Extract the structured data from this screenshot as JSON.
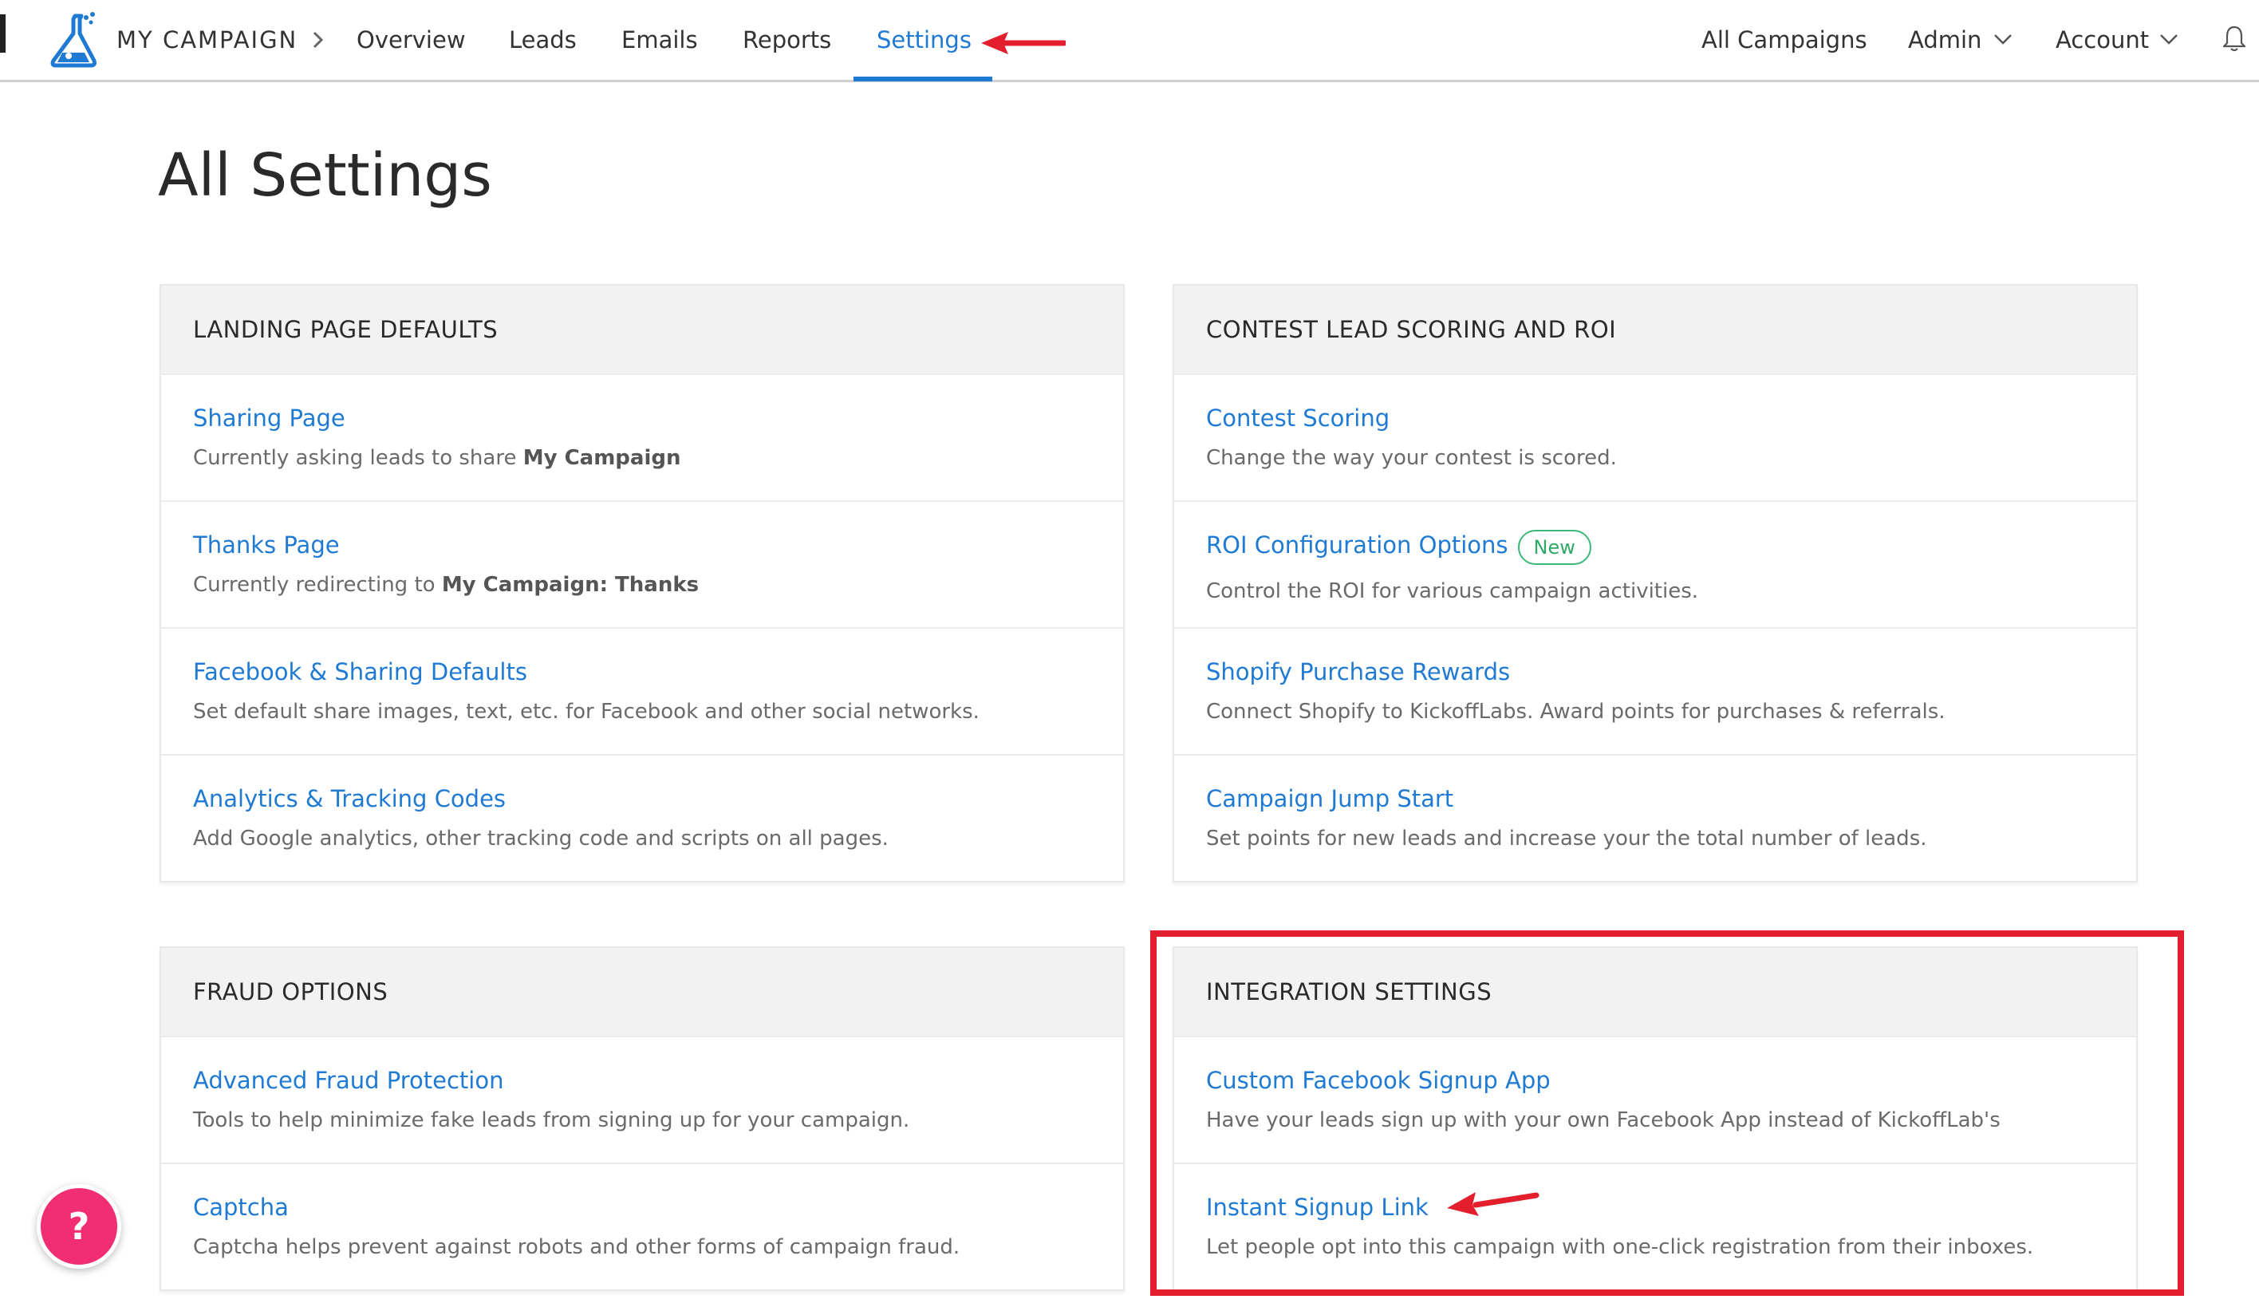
{
  "nav": {
    "brand": "MY CAMPAIGN",
    "tabs": [
      {
        "label": "Overview"
      },
      {
        "label": "Leads"
      },
      {
        "label": "Emails"
      },
      {
        "label": "Reports"
      },
      {
        "label": "Settings",
        "active": true
      }
    ],
    "right": {
      "all_campaigns": "All Campaigns",
      "admin": "Admin",
      "account": "Account"
    },
    "icons": [
      "flask-logo-icon",
      "chevron-right-icon",
      "chevron-down-icon",
      "bell-icon"
    ]
  },
  "page": {
    "title": "All Settings"
  },
  "sections": {
    "landing": {
      "heading": "LANDING PAGE DEFAULTS",
      "rows": [
        {
          "link": "Sharing Page",
          "desc": "Currently asking leads to share ",
          "strong": "My Campaign"
        },
        {
          "link": "Thanks Page",
          "desc": "Currently redirecting to ",
          "strong": "My Campaign: Thanks"
        },
        {
          "link": "Facebook & Sharing Defaults",
          "desc": "Set default share images, text, etc. for Facebook and other social networks."
        },
        {
          "link": "Analytics & Tracking Codes",
          "desc": "Add Google analytics, other tracking code and scripts on all pages."
        }
      ]
    },
    "contest": {
      "heading": "CONTEST LEAD SCORING AND ROI",
      "rows": [
        {
          "link": "Contest Scoring",
          "desc": "Change the way your contest is scored."
        },
        {
          "link": "ROI Configuration Options",
          "badge": "New",
          "desc": "Control the ROI for various campaign activities."
        },
        {
          "link": "Shopify Purchase Rewards",
          "desc": "Connect Shopify to KickoffLabs. Award points for purchases & referrals."
        },
        {
          "link": "Campaign Jump Start",
          "desc": "Set points for new leads and increase your the total number of leads."
        }
      ]
    },
    "fraud": {
      "heading": "FRAUD OPTIONS",
      "rows": [
        {
          "link": "Advanced Fraud Protection",
          "desc": "Tools to help minimize fake leads from signing up for your campaign."
        },
        {
          "link": "Captcha",
          "desc": "Captcha helps prevent against robots and other forms of campaign fraud."
        }
      ]
    },
    "integration": {
      "heading": "INTEGRATION SETTINGS",
      "rows": [
        {
          "link": "Custom Facebook Signup App",
          "desc": "Have your leads sign up with your own Facebook App instead of KickoffLab's"
        },
        {
          "link": "Instant Signup Link",
          "desc": "Let people opt into this campaign with one-click registration from their inboxes."
        }
      ]
    }
  },
  "help": {
    "label": "?"
  },
  "colors": {
    "accent_blue": "#1f7ad3",
    "annotation_red": "#e31e2d",
    "badge_green": "#3cb878",
    "help_pink": "#f12e74",
    "header_gray": "#f2f2f2"
  }
}
